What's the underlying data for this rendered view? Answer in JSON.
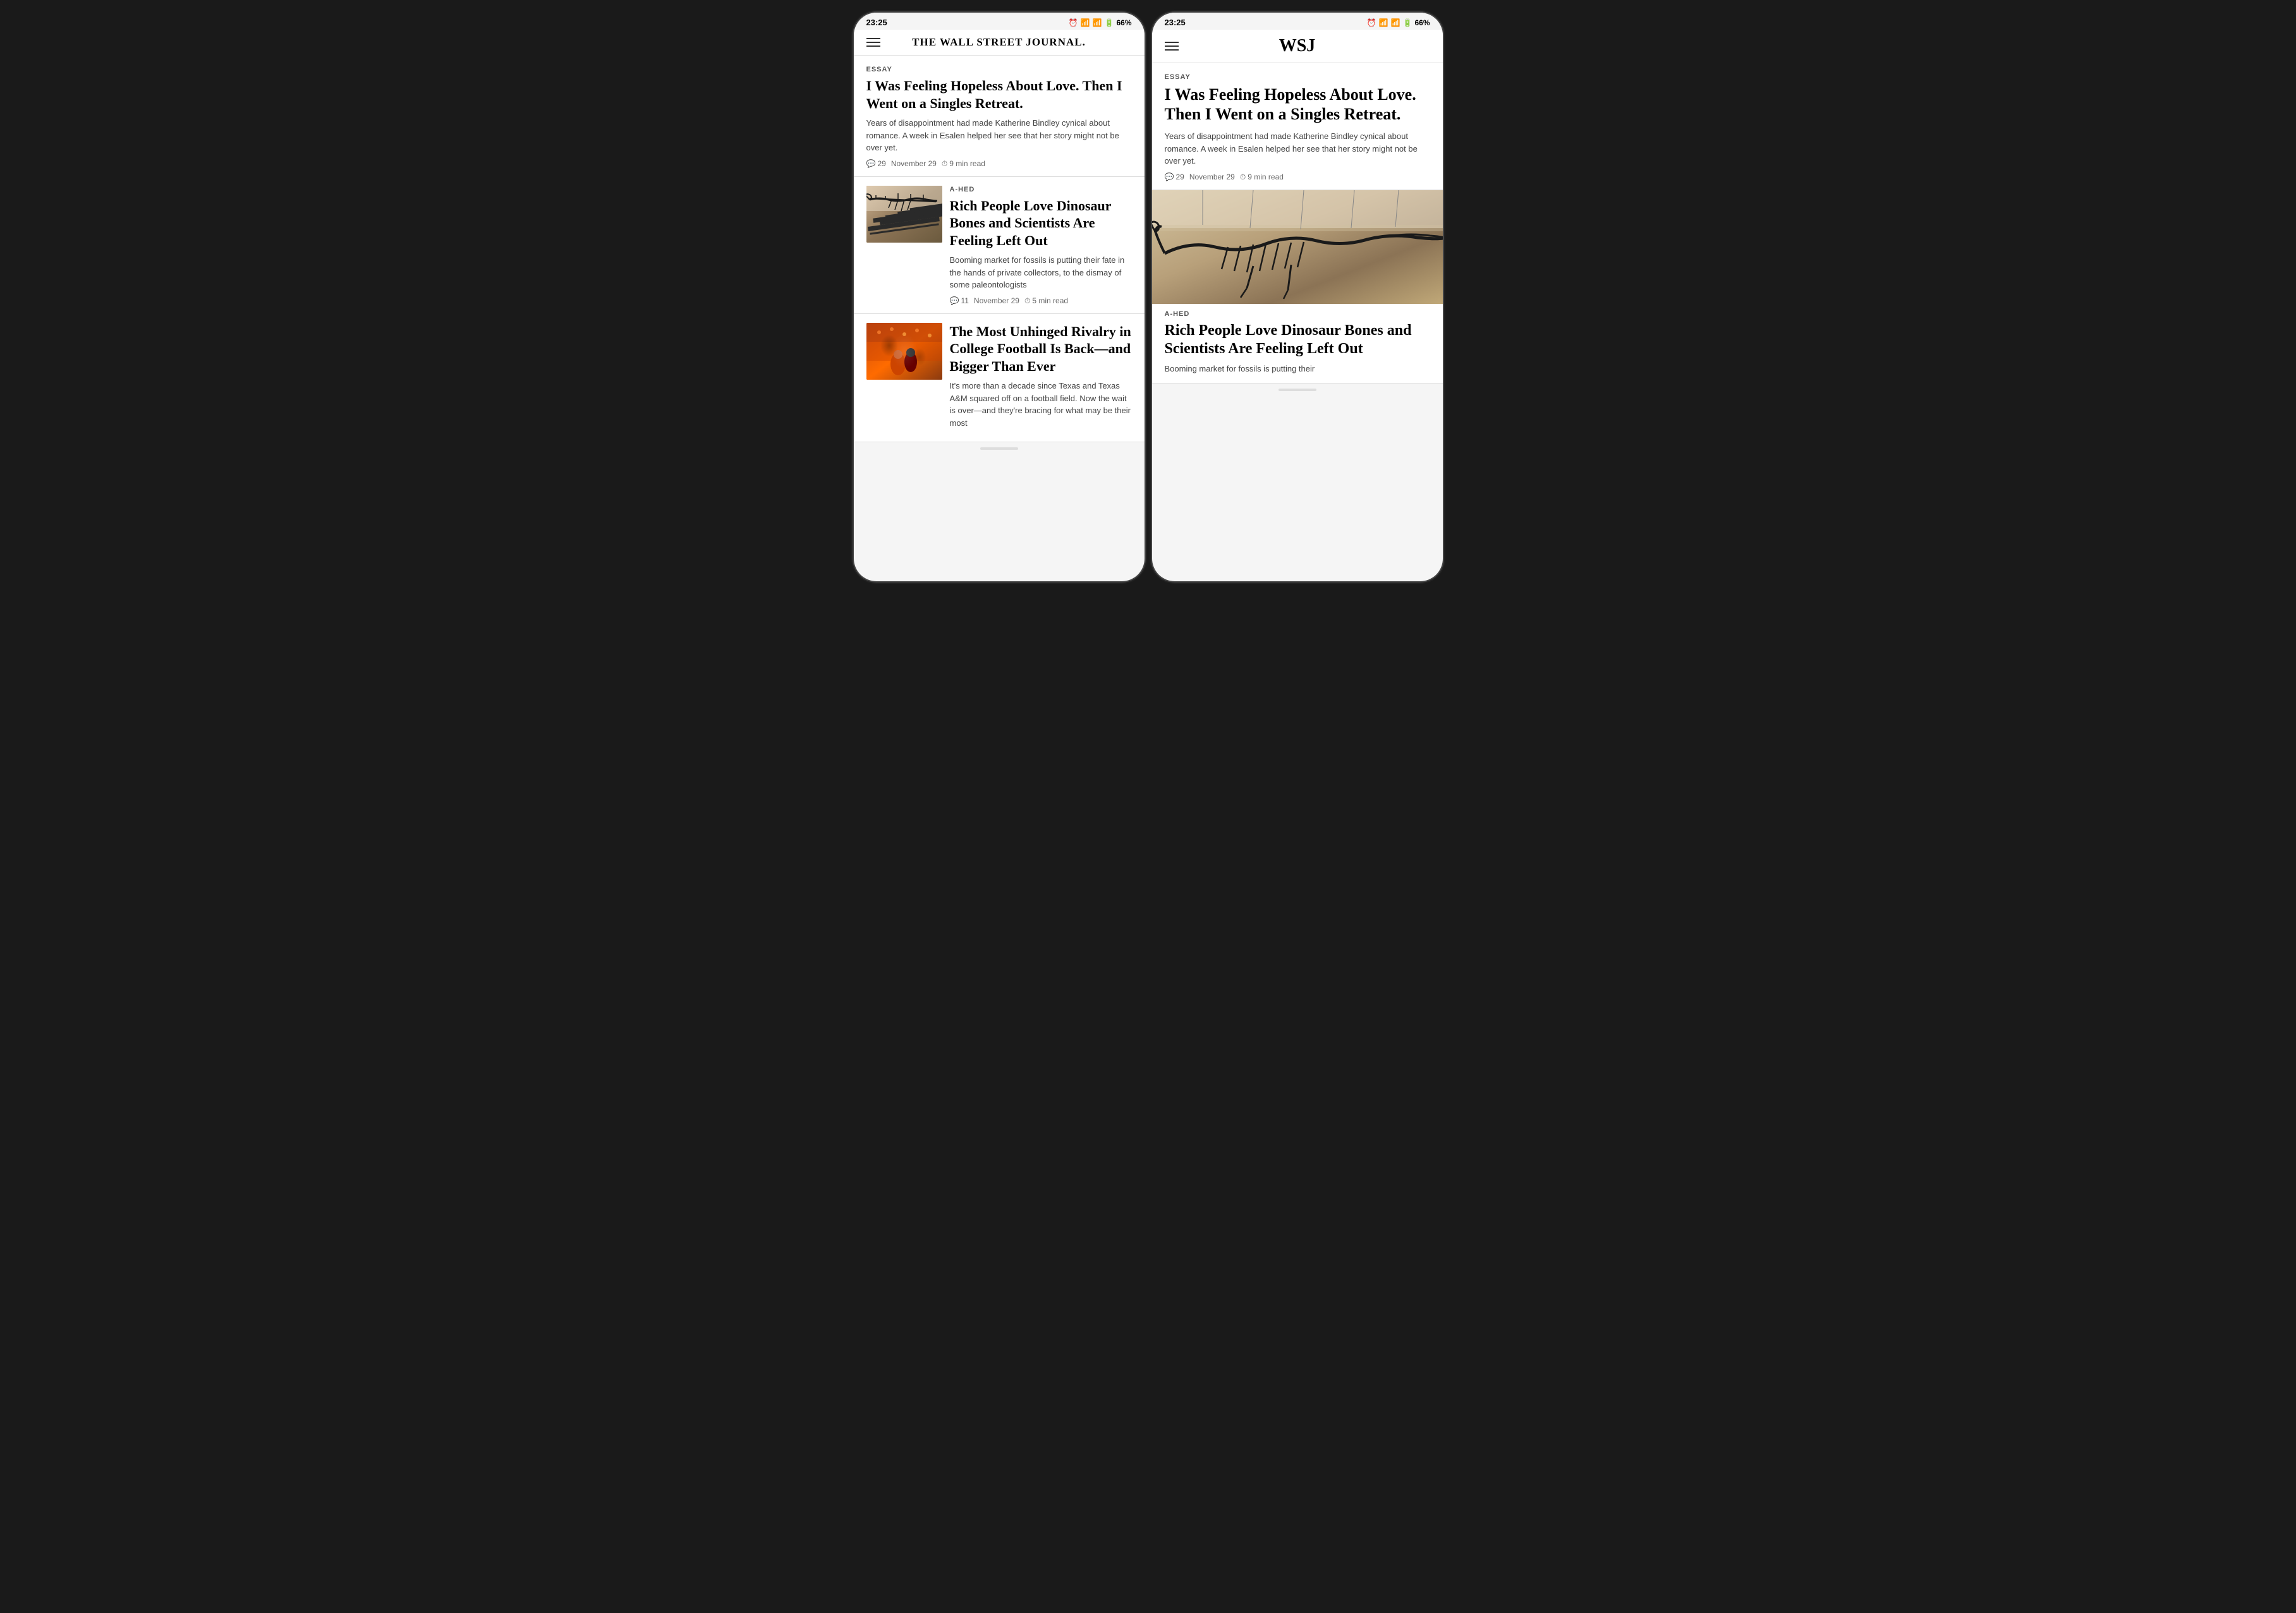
{
  "phones": [
    {
      "id": "left",
      "statusBar": {
        "time": "23:25",
        "icons": "⏰ 📶 📶 📶 🔋",
        "battery": "66%"
      },
      "header": {
        "logo": "THE WALL STREET JOURNAL.",
        "type": "full"
      },
      "articles": [
        {
          "id": "essay-left",
          "category": "ESSAY",
          "title": "I Was Feeling Hopeless About Love. Then I Went on a Singles Retreat.",
          "summary": "Years of disappointment had made Katherine Bindley cynical about romance. A week in Esalen helped her see that her story might not be over yet.",
          "comments": "29",
          "date": "November 29",
          "readTime": "9 min read",
          "hasImage": false
        },
        {
          "id": "dino-left",
          "category": "A-HED",
          "title": "Rich People Love Dinosaur Bones and Scientists Are Feeling Left Out",
          "summary": "Booming market for fossils is putting their fate in the hands of private collectors, to the dismay of some paleontologists",
          "comments": "11",
          "date": "November 29",
          "readTime": "5 min read",
          "hasImage": true,
          "imageType": "dino"
        },
        {
          "id": "football-left",
          "category": "",
          "title": "The Most Unhinged Rivalry in College Football Is Back—and Bigger Than Ever",
          "summary": "It's more than a decade since Texas and Texas A&M squared off on a football field. Now the wait is over—and they're bracing for what may be their most",
          "hasImage": true,
          "imageType": "football"
        }
      ]
    },
    {
      "id": "right",
      "statusBar": {
        "time": "23:25",
        "battery": "66%"
      },
      "header": {
        "logo": "WSJ",
        "type": "short"
      },
      "articles": [
        {
          "id": "essay-right",
          "category": "ESSAY",
          "title": "I Was Feeling Hopeless About Love. Then I Went on a Singles Retreat.",
          "summary": "Years of disappointment had made Katherine Bindley cynical about romance. A week in Esalen helped her see that her story might not be over yet.",
          "comments": "29",
          "date": "November 29",
          "readTime": "9 min read",
          "hasImage": false
        },
        {
          "id": "dino-right",
          "category": "A-HED",
          "title": "Rich People Love Dinosaur Bones and Scientists Are Feeling Left Out",
          "summary": "Booming market for fossils is putting their",
          "hasImage": true,
          "imageType": "dino-full"
        }
      ]
    }
  ],
  "icons": {
    "hamburger": "≡",
    "comment": "💬",
    "clock": "⏱"
  }
}
